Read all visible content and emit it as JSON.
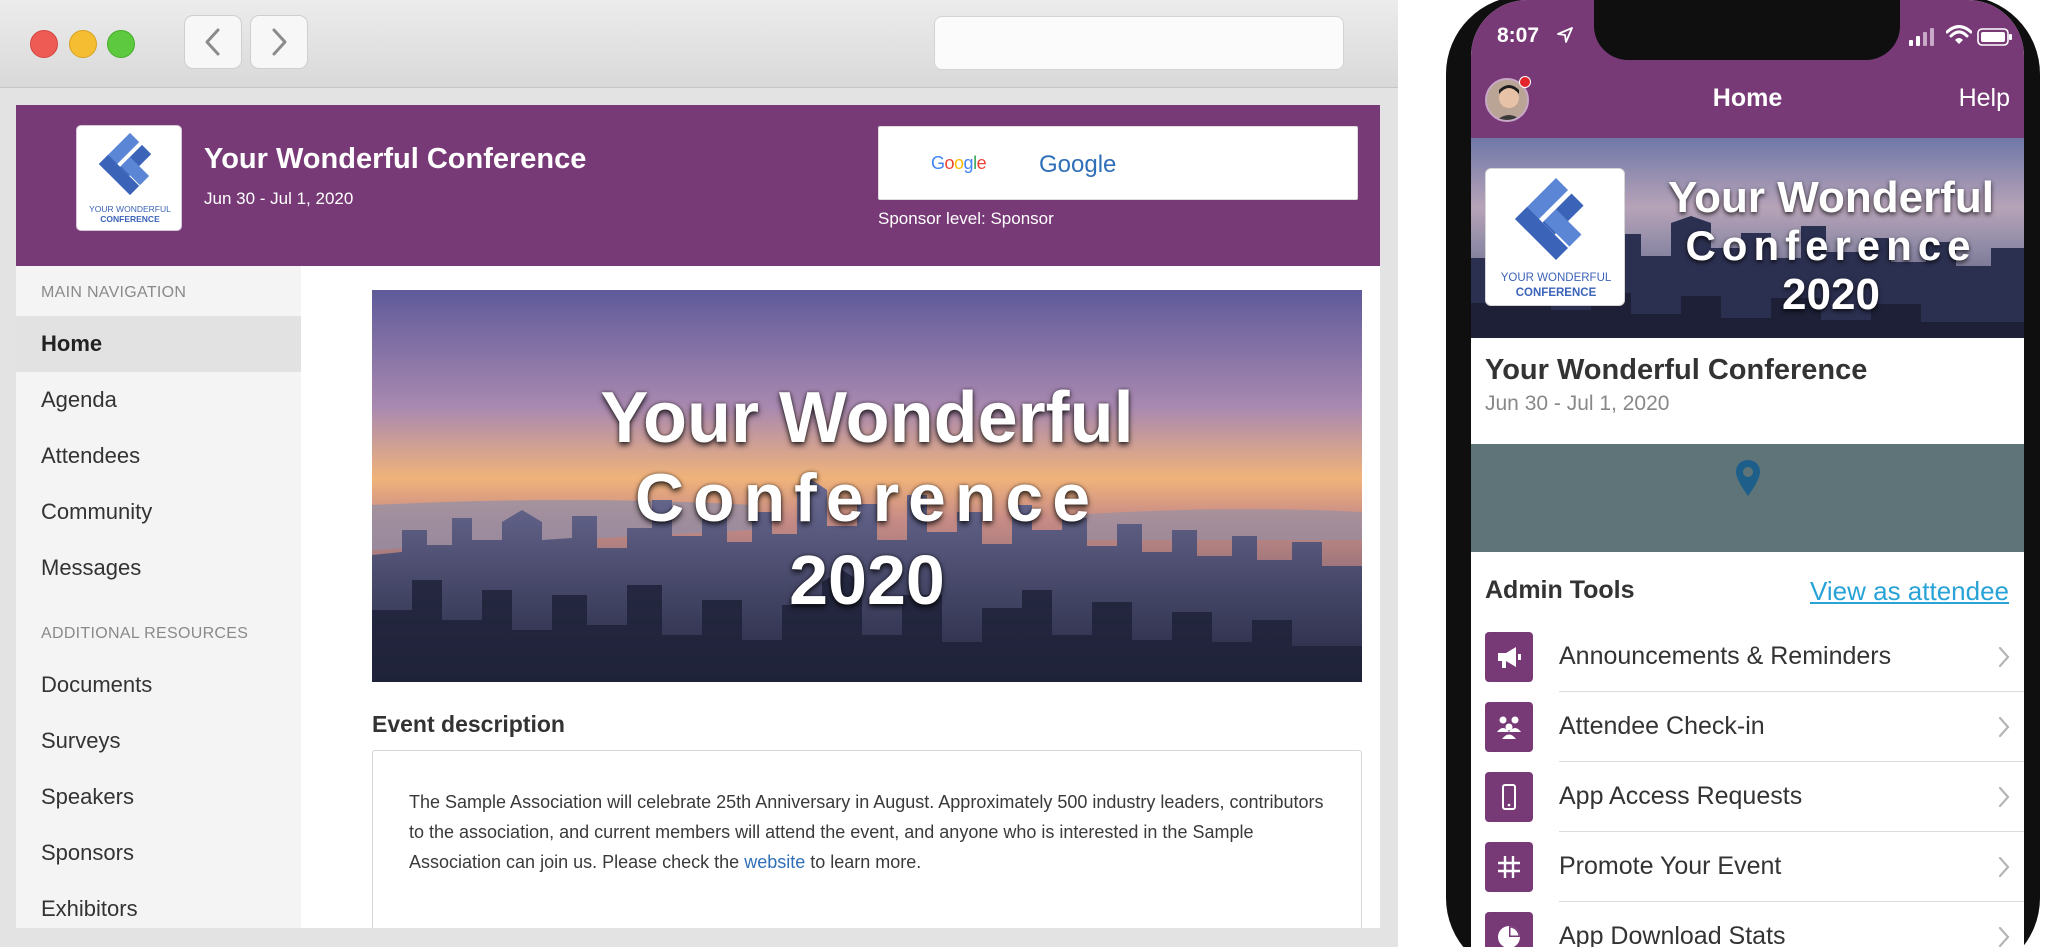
{
  "desktop": {
    "header": {
      "logo_line1": "YOUR WONDERFUL",
      "logo_line2": "CONFERENCE",
      "title": "Your Wonderful Conference",
      "dates": "Jun 30 - Jul 1, 2020",
      "sponsor_logo_text": "Google",
      "sponsor_name": "Google",
      "sponsor_level": "Sponsor level: Sponsor"
    },
    "sidebar": {
      "main_heading": "MAIN NAVIGATION",
      "main_items": [
        {
          "label": "Home",
          "active": true
        },
        {
          "label": "Agenda"
        },
        {
          "label": "Attendees"
        },
        {
          "label": "Community"
        },
        {
          "label": "Messages"
        }
      ],
      "additional_heading": "ADDITIONAL RESOURCES",
      "additional_items": [
        {
          "label": "Documents"
        },
        {
          "label": "Surveys"
        },
        {
          "label": "Speakers"
        },
        {
          "label": "Sponsors"
        },
        {
          "label": "Exhibitors"
        }
      ]
    },
    "banner": {
      "line1": "Your Wonderful",
      "line2": "Conference",
      "line3": "2020"
    },
    "description": {
      "heading": "Event description",
      "text_before_link": "The Sample Association will celebrate 25th Anniversary in August. Approximately 500 industry leaders, contributors to the association, and current members will attend the event, and anyone who is interested in the Sample Association can join us. Please check the ",
      "link_text": "website",
      "text_after_link": " to learn more."
    }
  },
  "mobile": {
    "status": {
      "time": "8:07"
    },
    "appbar": {
      "title": "Home",
      "help": "Help"
    },
    "banner": {
      "logo_line1": "YOUR WONDERFUL",
      "logo_line2": "CONFERENCE",
      "line1": "Your Wonderful",
      "line2": "Conference",
      "line3": "2020"
    },
    "event": {
      "title": "Your Wonderful Conference",
      "dates": "Jun 30 - Jul 1, 2020"
    },
    "admin": {
      "heading": "Admin Tools",
      "view_as_attendee": "View as attendee",
      "tools": [
        {
          "label": "Announcements & Reminders",
          "icon": "megaphone-icon"
        },
        {
          "label": "Attendee Check-in",
          "icon": "people-icon"
        },
        {
          "label": "App Access Requests",
          "icon": "phone-icon"
        },
        {
          "label": "Promote Your Event",
          "icon": "hashtag-icon"
        },
        {
          "label": "App Download Stats",
          "icon": "pie-chart-icon"
        }
      ]
    }
  },
  "colors": {
    "brand_purple": "#783a77",
    "logo_blue": "#3b63b8",
    "link_blue": "#2f6fb7",
    "view_link": "#29a3d7",
    "map_slate": "#5f7478"
  }
}
